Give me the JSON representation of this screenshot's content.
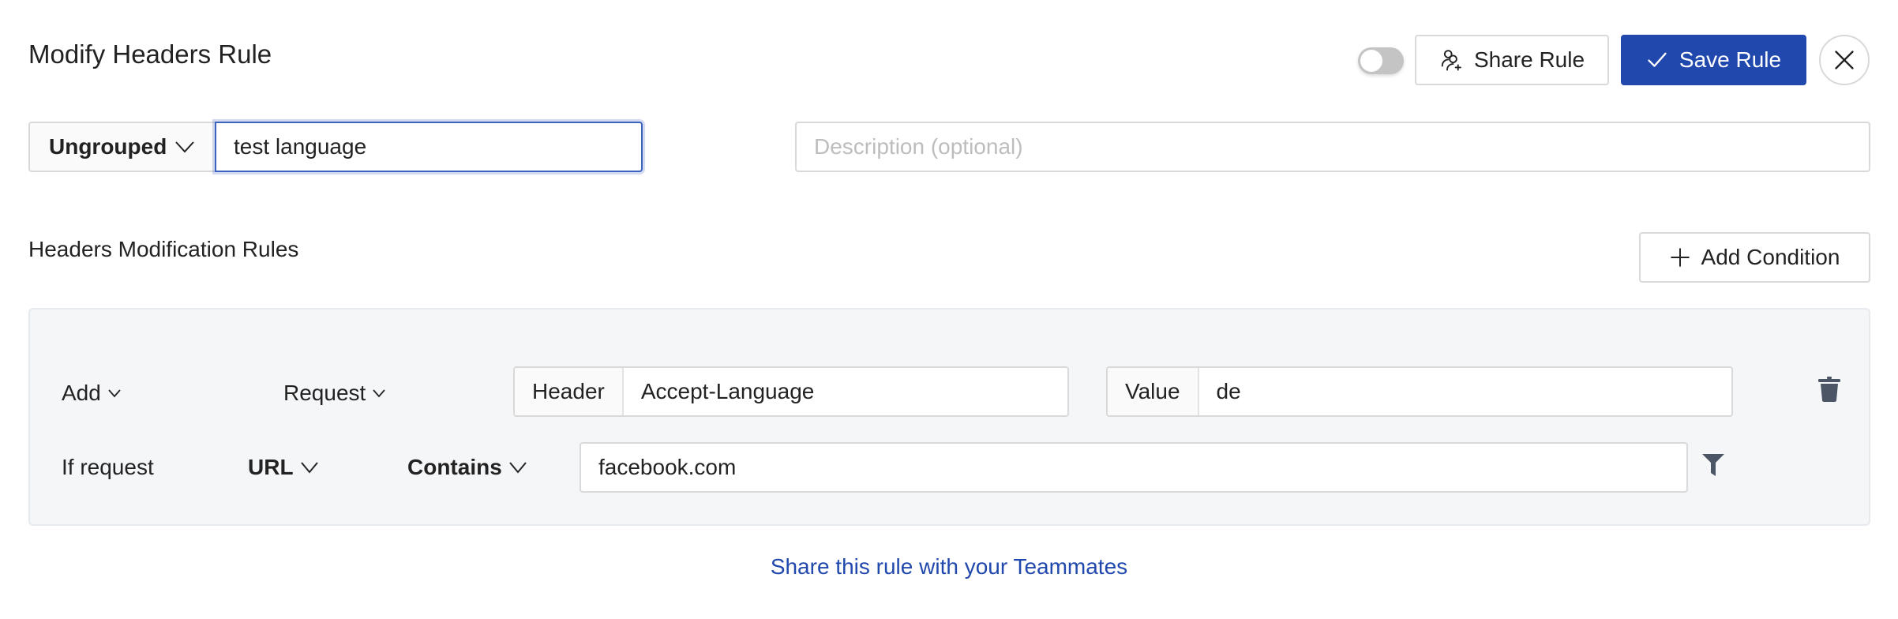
{
  "header": {
    "title": "Modify Headers Rule",
    "status_toggle": {
      "enabled": false
    },
    "share_button_label": "Share Rule",
    "save_button_label": "Save Rule",
    "close_icon": "close-icon"
  },
  "rule_info": {
    "group_label": "Ungrouped",
    "name_value": "test language",
    "description_placeholder": "Description (optional)",
    "description_value": ""
  },
  "section": {
    "title": "Headers Modification Rules",
    "add_condition_label": "Add Condition"
  },
  "modification": {
    "action": "Add",
    "target": "Request",
    "header_label": "Header",
    "header_value": "Accept-Language",
    "value_label": "Value",
    "value_value": "de"
  },
  "condition": {
    "label": "If request",
    "field": "URL",
    "operator": "Contains",
    "value": "facebook.com"
  },
  "footer": {
    "share_link": "Share this rule with your Teammates"
  },
  "colors": {
    "primary": "#2148ad",
    "panel_bg": "#f5f6f8",
    "icon_gray": "#4b5565"
  }
}
